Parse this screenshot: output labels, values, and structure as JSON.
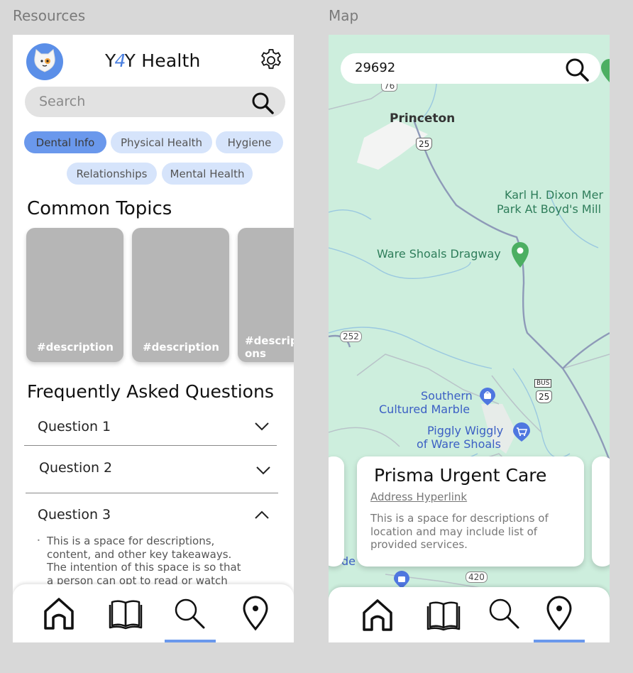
{
  "frames": {
    "resources_label": "Resources",
    "map_label": "Map"
  },
  "resources": {
    "logo": {
      "part1": "Y",
      "part2": "4",
      "part3": "Y",
      "part4": "Health"
    },
    "search": {
      "placeholder": "Search"
    },
    "chips": [
      {
        "label": "Dental Info",
        "active": true
      },
      {
        "label": "Physical Health",
        "active": false
      },
      {
        "label": "Hygiene",
        "active": false
      },
      {
        "label": "Relationships",
        "active": false
      },
      {
        "label": "Mental Health",
        "active": false
      }
    ],
    "common_topics_title": "Common Topics",
    "cards": [
      {
        "label": "#description"
      },
      {
        "label": "#description"
      },
      {
        "label": "#descrip ons"
      }
    ],
    "faq_title": "Frequently Asked Questions",
    "questions": [
      {
        "label": "Question 1",
        "expanded": false
      },
      {
        "label": "Question 2",
        "expanded": false
      },
      {
        "label": "Question 3",
        "expanded": true
      }
    ],
    "answer_text": "This is a space for descriptions, content, and other key takeaways. The intention of this space is so that a person can opt to read or watch",
    "nav_active": "search",
    "accent_color": "#6a98ec",
    "chip_color": "#d6e4fb"
  },
  "map": {
    "search": {
      "value": "29692"
    },
    "labels": {
      "princeton": "Princeton",
      "karl_line1": "Karl H. Dixon Mer",
      "karl_line2": "Park At Boyd's Mill",
      "dragway": "Ware Shoals Dragway",
      "southern_line1": "Southern",
      "southern_line2": "Cultured Marble",
      "piggly_line1": "Piggly Wiggly",
      "piggly_line2": "of Ware Shoals",
      "partial": "de"
    },
    "road_shields": {
      "r76": "76",
      "r25": "25",
      "r252": "252",
      "bus": "BUS",
      "bus25": "25",
      "r420": "420"
    },
    "card": {
      "title": "Prisma Urgent Care",
      "address": "Address Hyperlink",
      "description": "This is a space for descriptions of location and may include list of provided services."
    },
    "nav_active": "location",
    "map_color": "#cdeedd"
  }
}
